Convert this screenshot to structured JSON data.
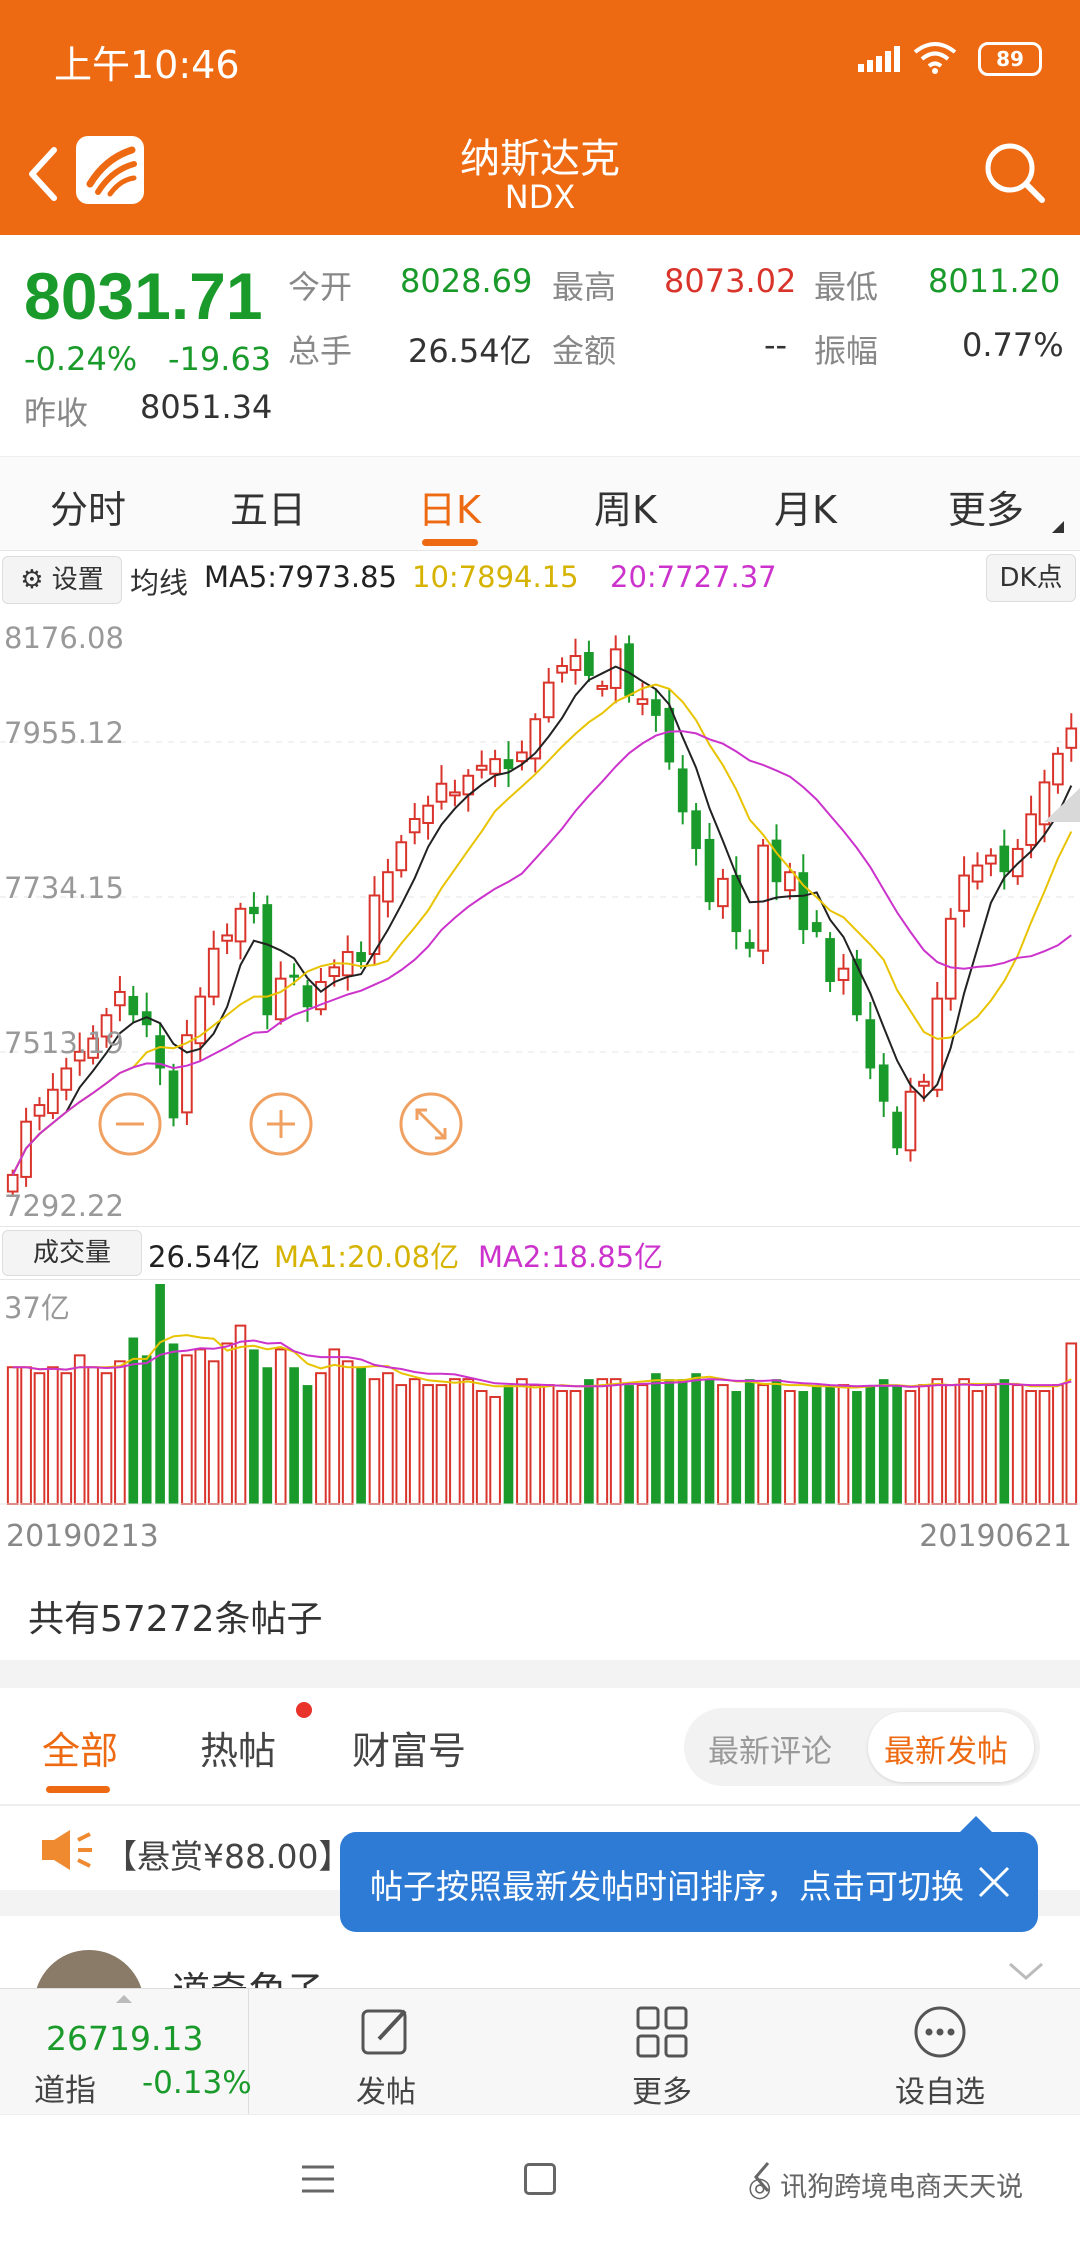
{
  "status": {
    "time": "上午10:46",
    "battery": "89"
  },
  "header": {
    "title": "纳斯达克",
    "code": "NDX"
  },
  "quote": {
    "price": "8031.71",
    "change_pct": "-0.24%",
    "change": "-19.63",
    "prev_close_label": "昨收",
    "prev_close": "8051.34",
    "open_label": "今开",
    "open": "8028.69",
    "high_label": "最高",
    "high": "8073.02",
    "low_label": "最低",
    "low": "8011.20",
    "volume_label": "总手",
    "volume": "26.54亿",
    "amount_label": "金额",
    "amount": "--",
    "amplitude_label": "振幅",
    "amplitude": "0.77%"
  },
  "tabs": [
    "分时",
    "五日",
    "日K",
    "周K",
    "月K",
    "更多"
  ],
  "active_tab": "日K",
  "chart_toolbar": {
    "settings": "设置",
    "ma_label": "均线",
    "ma5": "MA5:7973.85",
    "ma10": "10:7894.15",
    "ma20": "20:7727.37",
    "dk": "DK点"
  },
  "volume_toolbar": {
    "label": "成交量",
    "value": "26.54亿",
    "ma1": "MA1:20.08亿",
    "ma2": "MA2:18.85亿"
  },
  "chart_data": {
    "type": "candlestick",
    "price_axis_labels": [
      "8176.08",
      "7955.12",
      "7734.15",
      "7513.19",
      "7292.22"
    ],
    "ylim": [
      7292.22,
      8176.08
    ],
    "volume_axis_label": "37亿",
    "x_start": "20190213",
    "x_end": "20190621",
    "colors": {
      "up": "#d9342b",
      "down": "#1a9a2a",
      "ma5": "#222222",
      "ma10": "#e8c300",
      "ma20": "#cc33cc"
    },
    "closes": [
      7360,
      7440,
      7465,
      7488,
      7520,
      7545,
      7565,
      7600,
      7635,
      7600,
      7585,
      7520,
      7445,
      7570,
      7628,
      7700,
      7720,
      7760,
      7752,
      7600,
      7655,
      7660,
      7612,
      7650,
      7672,
      7695,
      7680,
      7780,
      7815,
      7860,
      7895,
      7915,
      7948,
      7935,
      7960,
      7975,
      7985,
      7970,
      7995,
      8045,
      8100,
      8125,
      8140,
      8110,
      8095,
      8150,
      8080,
      8075,
      8050,
      7980,
      7905,
      7850,
      7770,
      7805,
      7725,
      7700,
      7855,
      7800,
      7815,
      7728,
      7725,
      7650,
      7670,
      7600,
      7520,
      7470,
      7400,
      7485,
      7500,
      7625,
      7745,
      7810,
      7825,
      7840,
      7815,
      7850,
      7902,
      7950,
      7993,
      8031
    ],
    "volumes": [
      23,
      23,
      22,
      23,
      22,
      25,
      23,
      22,
      24,
      28,
      25,
      37,
      27,
      25,
      26,
      24,
      27,
      30,
      26,
      23,
      26,
      23,
      20,
      22,
      26,
      24,
      23,
      21,
      22,
      20,
      21,
      20,
      20,
      21,
      21,
      19,
      18,
      20,
      21,
      20,
      20,
      19,
      19,
      21,
      21,
      21,
      20,
      20,
      22,
      21,
      21,
      22,
      21,
      20,
      19,
      21,
      20,
      21,
      19,
      19,
      20,
      20,
      20,
      19,
      20,
      21,
      20,
      19,
      20,
      21,
      20,
      21,
      19,
      20,
      21,
      20,
      19,
      19,
      20,
      27
    ],
    "ma5_last": 7973.85,
    "ma10_last": 7894.15,
    "ma20_last": 7727.37
  },
  "posts": {
    "count_text": "共有57272条帖子",
    "tabs": [
      "全部",
      "热帖",
      "财富号"
    ],
    "sort_options": [
      "最新评论",
      "最新发帖"
    ],
    "notice": "【悬赏¥88.00】",
    "tooltip": "帖子按照最新发帖时间排序，点击可切换",
    "first_user": "道奇角子"
  },
  "bottom_bar": {
    "index_value": "26719.13",
    "index_name": "道指",
    "index_change": "-0.13%",
    "post": "发帖",
    "more": "更多",
    "watchlist": "设自选"
  },
  "watermark": "讯狗跨境电商天天说"
}
